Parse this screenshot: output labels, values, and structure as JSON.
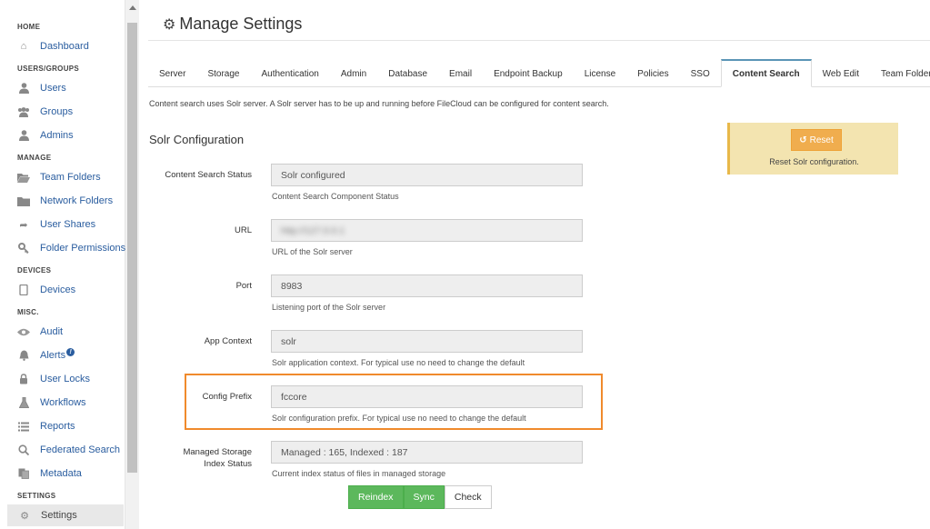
{
  "sidebar": {
    "sections": {
      "home": "HOME",
      "users_groups": "USERS/GROUPS",
      "manage": "MANAGE",
      "devices": "DEVICES",
      "misc": "MISC.",
      "settings": "SETTINGS"
    },
    "items": {
      "dashboard": "Dashboard",
      "users": "Users",
      "groups": "Groups",
      "admins": "Admins",
      "team_folders": "Team Folders",
      "network_folders": "Network Folders",
      "user_shares": "User Shares",
      "folder_permissions": "Folder Permissions",
      "devices": "Devices",
      "audit": "Audit",
      "alerts": "Alerts",
      "alerts_badge": "!",
      "user_locks": "User Locks",
      "workflows": "Workflows",
      "reports": "Reports",
      "federated_search": "Federated Search",
      "metadata": "Metadata",
      "settings": "Settings"
    }
  },
  "page": {
    "title": "Manage Settings",
    "tabs": [
      "Server",
      "Storage",
      "Authentication",
      "Admin",
      "Database",
      "Email",
      "Endpoint Backup",
      "License",
      "Policies",
      "SSO",
      "Content Search",
      "Web Edit",
      "Team Folders"
    ],
    "active_tab": "Content Search",
    "intro": "Content search uses Solr server. A Solr server has to be up and running before FileCloud can be configured for content search.",
    "section_title": "Solr Configuration"
  },
  "form": {
    "status": {
      "label": "Content Search Status",
      "value": "Solr configured",
      "help": "Content Search Component Status"
    },
    "url": {
      "label": "URL",
      "value": "http://127.0.0.1",
      "help": "URL of the Solr server"
    },
    "port": {
      "label": "Port",
      "value": "8983",
      "help": "Listening port of the Solr server"
    },
    "app_context": {
      "label": "App Context",
      "value": "solr",
      "help": "Solr application context. For typical use no need to change the default"
    },
    "config_prefix": {
      "label": "Config Prefix",
      "value": "fccore",
      "help": "Solr configuration prefix. For typical use no need to change the default"
    },
    "managed_storage": {
      "label_line1": "Managed Storage",
      "label_line2": "Index Status",
      "value": "Managed : 165, Indexed : 187",
      "help": "Current index status of files in managed storage"
    }
  },
  "buttons": {
    "reindex": "Reindex",
    "sync": "Sync",
    "check": "Check"
  },
  "reset_panel": {
    "button_label": "Reset",
    "note": "Reset Solr configuration."
  },
  "colors": {
    "link": "#2a5d9f",
    "highlight": "#f08a2c",
    "green": "#5cb85c",
    "reset": "#f0ad4e",
    "panel": "#f3e4b0"
  }
}
